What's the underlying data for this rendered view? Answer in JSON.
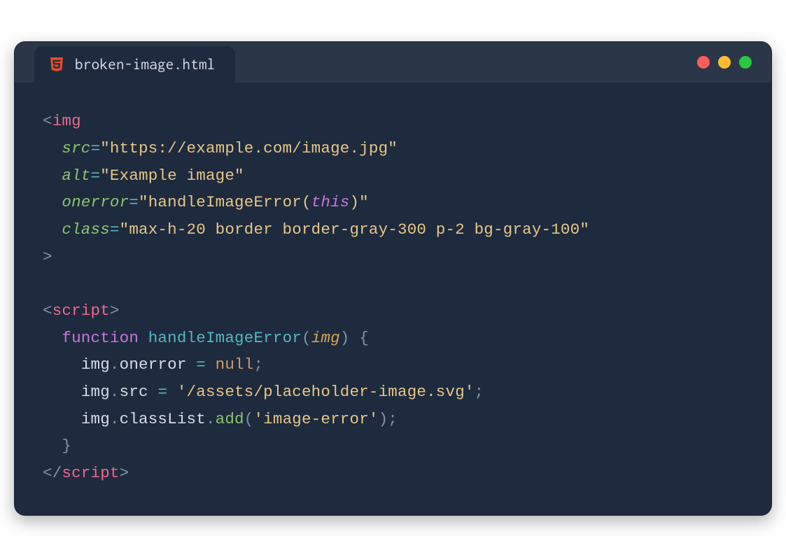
{
  "file": {
    "name": "broken-image.html",
    "icon": "html5-icon"
  },
  "window_controls": [
    "close",
    "minimize",
    "maximize"
  ],
  "code": {
    "lines": [
      {
        "tokens": [
          {
            "c": "punct",
            "t": "<"
          },
          {
            "c": "tag",
            "t": "img"
          }
        ]
      },
      {
        "tokens": [
          {
            "c": "",
            "t": "  "
          },
          {
            "c": "attr",
            "t": "src"
          },
          {
            "c": "op",
            "t": "="
          },
          {
            "c": "str",
            "t": "\"https://example.com/image.jpg\""
          }
        ]
      },
      {
        "tokens": [
          {
            "c": "",
            "t": "  "
          },
          {
            "c": "attr",
            "t": "alt"
          },
          {
            "c": "op",
            "t": "="
          },
          {
            "c": "str",
            "t": "\"Example image\""
          }
        ]
      },
      {
        "tokens": [
          {
            "c": "",
            "t": "  "
          },
          {
            "c": "attr",
            "t": "onerror"
          },
          {
            "c": "op",
            "t": "="
          },
          {
            "c": "str",
            "t": "\"handleImageError("
          },
          {
            "c": "this",
            "t": "this"
          },
          {
            "c": "str",
            "t": ")\""
          }
        ]
      },
      {
        "tokens": [
          {
            "c": "",
            "t": "  "
          },
          {
            "c": "attr",
            "t": "class"
          },
          {
            "c": "op",
            "t": "="
          },
          {
            "c": "str",
            "t": "\"max-h-20 border border-gray-300 p-2 bg-gray-100\""
          }
        ]
      },
      {
        "tokens": [
          {
            "c": "punct",
            "t": ">"
          }
        ]
      },
      {
        "tokens": [
          {
            "c": "",
            "t": ""
          }
        ]
      },
      {
        "tokens": [
          {
            "c": "punct",
            "t": "<"
          },
          {
            "c": "tag",
            "t": "script"
          },
          {
            "c": "punct",
            "t": ">"
          }
        ]
      },
      {
        "tokens": [
          {
            "c": "",
            "t": "  "
          },
          {
            "c": "kw",
            "t": "function"
          },
          {
            "c": "",
            "t": " "
          },
          {
            "c": "fn-name",
            "t": "handleImageError"
          },
          {
            "c": "punct",
            "t": "("
          },
          {
            "c": "param",
            "t": "img"
          },
          {
            "c": "punct",
            "t": ") {"
          }
        ]
      },
      {
        "tokens": [
          {
            "c": "",
            "t": "    "
          },
          {
            "c": "prop",
            "t": "img"
          },
          {
            "c": "punct",
            "t": "."
          },
          {
            "c": "prop",
            "t": "onerror"
          },
          {
            "c": "",
            "t": " "
          },
          {
            "c": "op",
            "t": "="
          },
          {
            "c": "",
            "t": " "
          },
          {
            "c": "nullkw",
            "t": "null"
          },
          {
            "c": "punct",
            "t": ";"
          }
        ]
      },
      {
        "tokens": [
          {
            "c": "",
            "t": "    "
          },
          {
            "c": "prop",
            "t": "img"
          },
          {
            "c": "punct",
            "t": "."
          },
          {
            "c": "prop",
            "t": "src"
          },
          {
            "c": "",
            "t": " "
          },
          {
            "c": "op",
            "t": "="
          },
          {
            "c": "",
            "t": " "
          },
          {
            "c": "str",
            "t": "'/assets/placeholder-image.svg'"
          },
          {
            "c": "punct",
            "t": ";"
          }
        ]
      },
      {
        "tokens": [
          {
            "c": "",
            "t": "    "
          },
          {
            "c": "prop",
            "t": "img"
          },
          {
            "c": "punct",
            "t": "."
          },
          {
            "c": "prop",
            "t": "classList"
          },
          {
            "c": "punct",
            "t": "."
          },
          {
            "c": "method",
            "t": "add"
          },
          {
            "c": "punct",
            "t": "("
          },
          {
            "c": "str",
            "t": "'image-error'"
          },
          {
            "c": "punct",
            "t": ");"
          }
        ]
      },
      {
        "tokens": [
          {
            "c": "",
            "t": "  "
          },
          {
            "c": "punct",
            "t": "}"
          }
        ]
      },
      {
        "tokens": [
          {
            "c": "punct",
            "t": "</"
          },
          {
            "c": "tag",
            "t": "script"
          },
          {
            "c": "punct",
            "t": ">"
          }
        ]
      }
    ]
  }
}
